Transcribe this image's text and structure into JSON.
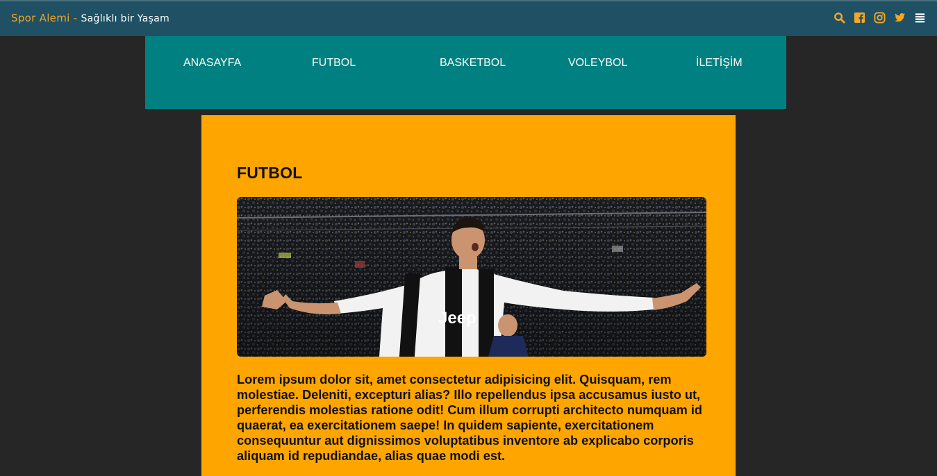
{
  "header": {
    "brand_name": "Spor Alemi",
    "brand_separator": " - ",
    "tagline": "Sağlıklı bir Yaşam",
    "icons": [
      "search-icon",
      "facebook-icon",
      "instagram-icon",
      "twitter-icon",
      "menu-icon"
    ]
  },
  "nav": {
    "items": [
      {
        "label": "ANASAYFA"
      },
      {
        "label": "FUTBOL"
      },
      {
        "label": "BASKETBOL"
      },
      {
        "label": "VOLEYBOL"
      },
      {
        "label": "İLETİŞİM"
      }
    ]
  },
  "main": {
    "title": "FUTBOL",
    "image_alt": "football-player-celebrating",
    "body": "Lorem ipsum dolor sit, amet consectetur adipisicing elit. Quisquam, rem molestiae. Deleniti, excepturi alias? Illo repellendus ipsa accusamus iusto ut, perferendis molestias ratione odit! Cum illum corrupti architecto numquam id quaerat, ea exercitationem saepe! In quidem sapiente, exercitationem consequuntur aut dignissimos voluptatibus inventore ab explicabo corporis aliquam id repudiandae, alias quae modi est."
  },
  "colors": {
    "topbar": "#1f5064",
    "accent": "#f5a623",
    "nav": "#008080",
    "content": "#ffa500",
    "page": "#262626"
  }
}
